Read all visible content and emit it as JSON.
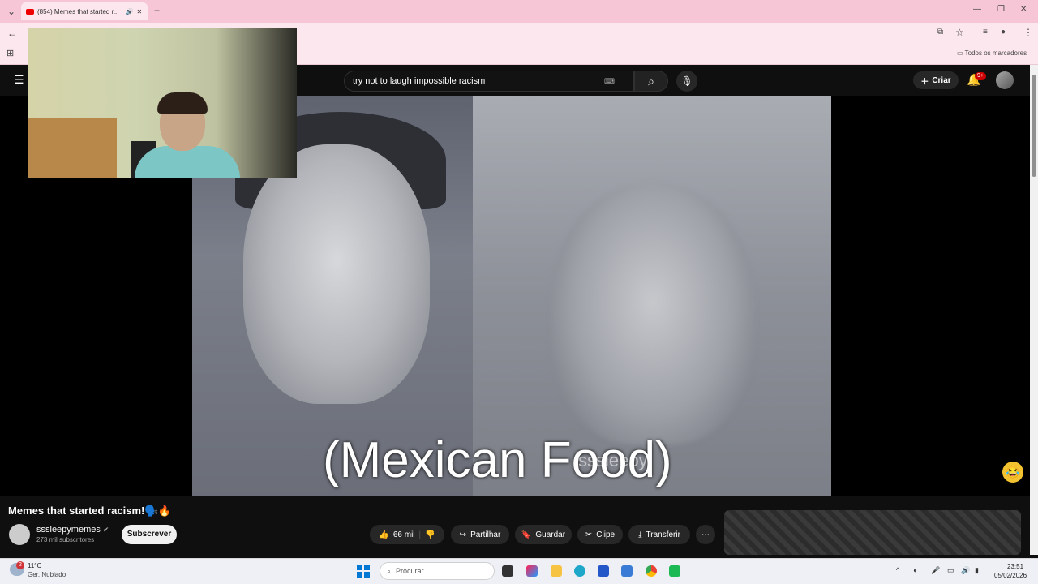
{
  "browser": {
    "tab_title": "(854) Memes that started r...",
    "bookmarks_label": "Todos os marcadores"
  },
  "youtube": {
    "search_value": "try not to laugh impossible racism",
    "create_label": "Criar",
    "notif_badge": "9+"
  },
  "video": {
    "caption": "(Mexican Food)",
    "watermark": "sssleepy"
  },
  "meta": {
    "title": "Memes that started racism!🗣️🔥",
    "channel_name": "sssleepymemes",
    "subscribers": "273 mil subscritores",
    "subscribe_label": "Subscrever",
    "actions": {
      "likes": "66 mil",
      "share": "Partilhar",
      "save": "Guardar",
      "clip": "Clipe",
      "download": "Transferir"
    }
  },
  "taskbar": {
    "temperature": "11°C",
    "weather_desc": "Ger. Nublado",
    "weather_badge": "2",
    "search_placeholder": "Procurar",
    "time": "23:51",
    "date": "05/02/2026"
  },
  "colors": {
    "tabbar": "#f6c6d6",
    "youtube_bg": "#0f0f0f",
    "notif_red": "#cc0000"
  }
}
